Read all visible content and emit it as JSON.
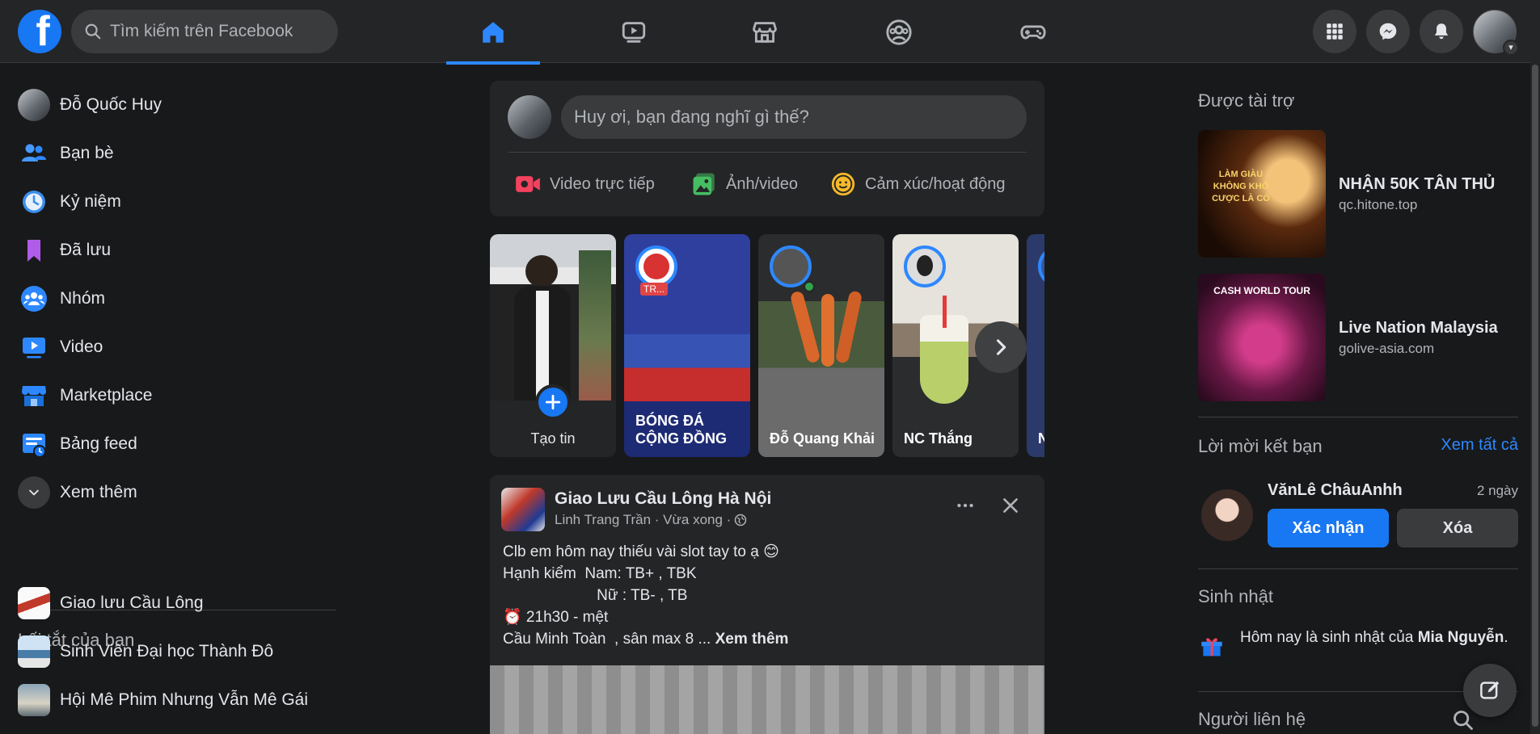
{
  "topbar": {
    "logo_letter": "f",
    "search_placeholder": "Tìm kiếm trên Facebook",
    "nav_tabs": [
      {
        "name": "home",
        "icon": "home-icon",
        "active": true
      },
      {
        "name": "watch",
        "icon": "video-play-icon",
        "active": false
      },
      {
        "name": "marketplace",
        "icon": "store-icon",
        "active": false
      },
      {
        "name": "groups",
        "icon": "groups-icon",
        "active": false
      },
      {
        "name": "gaming",
        "icon": "gamepad-icon",
        "active": false
      }
    ],
    "right_buttons": [
      "menu-grid-icon",
      "messenger-icon",
      "notification-bell-icon"
    ],
    "accent_color": "#2d88ff"
  },
  "sidebar": {
    "items": [
      {
        "label": "Đỗ Quốc Huy",
        "icon": "profile-avatar"
      },
      {
        "label": "Bạn bè",
        "icon": "friends-icon"
      },
      {
        "label": "Kỷ niệm",
        "icon": "memories-clock-icon"
      },
      {
        "label": "Đã lưu",
        "icon": "saved-bookmark-icon"
      },
      {
        "label": "Nhóm",
        "icon": "groups-icon"
      },
      {
        "label": "Video",
        "icon": "video-icon"
      },
      {
        "label": "Marketplace",
        "icon": "marketplace-icon"
      },
      {
        "label": "Bảng feed",
        "icon": "feeds-icon"
      },
      {
        "label": "Xem thêm",
        "icon": "chevron-down-icon"
      }
    ],
    "shortcuts_heading": "Lối tắt của bạn",
    "shortcuts": [
      {
        "label": "Giao lưu Cầu Lông"
      },
      {
        "label": "Sinh Viên Đại học Thành Đô"
      },
      {
        "label": "Hội Mê Phim Nhưng Vẫn Mê Gái"
      }
    ]
  },
  "composer": {
    "placeholder": "Huy ơi, bạn đang nghĩ gì thế?",
    "actions": [
      {
        "label": "Video trực tiếp",
        "icon": "live-video-icon"
      },
      {
        "label": "Ảnh/video",
        "icon": "photo-icon"
      },
      {
        "label": "Cảm xúc/hoạt động",
        "icon": "smiley-icon"
      }
    ]
  },
  "stories": {
    "create_label": "Tạo tin",
    "items": [
      {
        "name": "BÓNG ĐÁ CỘNG ĐỒNG",
        "badge": "TR..."
      },
      {
        "name": "Đỗ Quang Khải"
      },
      {
        "name": "NC Thắng"
      },
      {
        "name": "N C"
      }
    ]
  },
  "post": {
    "group": "Giao Lưu Cầu Lông Hà Nội",
    "author_line": "Linh Trang Trần · Vừa xong ·",
    "lines": [
      "Clb em hôm nay thiếu vài slot tay to ạ 😊",
      "Hạnh kiểm  Nam: TB+ , TBK",
      "                      Nữ : TB- , TB",
      "⏰ 21h30 - mệt",
      "Cầu Minh Toàn  , sân max 8 ... "
    ],
    "see_more": "Xem thêm"
  },
  "right": {
    "sponsored_heading": "Được tài trợ",
    "ads": [
      {
        "title": "NHẬN 50K TÂN THỦ",
        "site": "qc.hitone.top",
        "image_text": "LÀM GIÀU KHÔNG KHÓ CƯỢC LÀ CÓ"
      },
      {
        "title": "Live Nation Malaysia",
        "site": "golive-asia.com",
        "image_text": "CASH WORLD TOUR"
      }
    ],
    "friend_requests_heading": "Lời mời kết bạn",
    "see_all": "Xem tất cả",
    "request": {
      "name": "VănLê ChâuAnhh",
      "time": "2 ngày",
      "confirm": "Xác nhận",
      "delete": "Xóa"
    },
    "birthdays_heading": "Sinh nhật",
    "birthday_prefix": "Hôm nay là sinh nhật của ",
    "birthday_name": "Mia Nguyễn",
    "birthday_suffix": ".",
    "contacts_heading": "Người liên hệ"
  }
}
